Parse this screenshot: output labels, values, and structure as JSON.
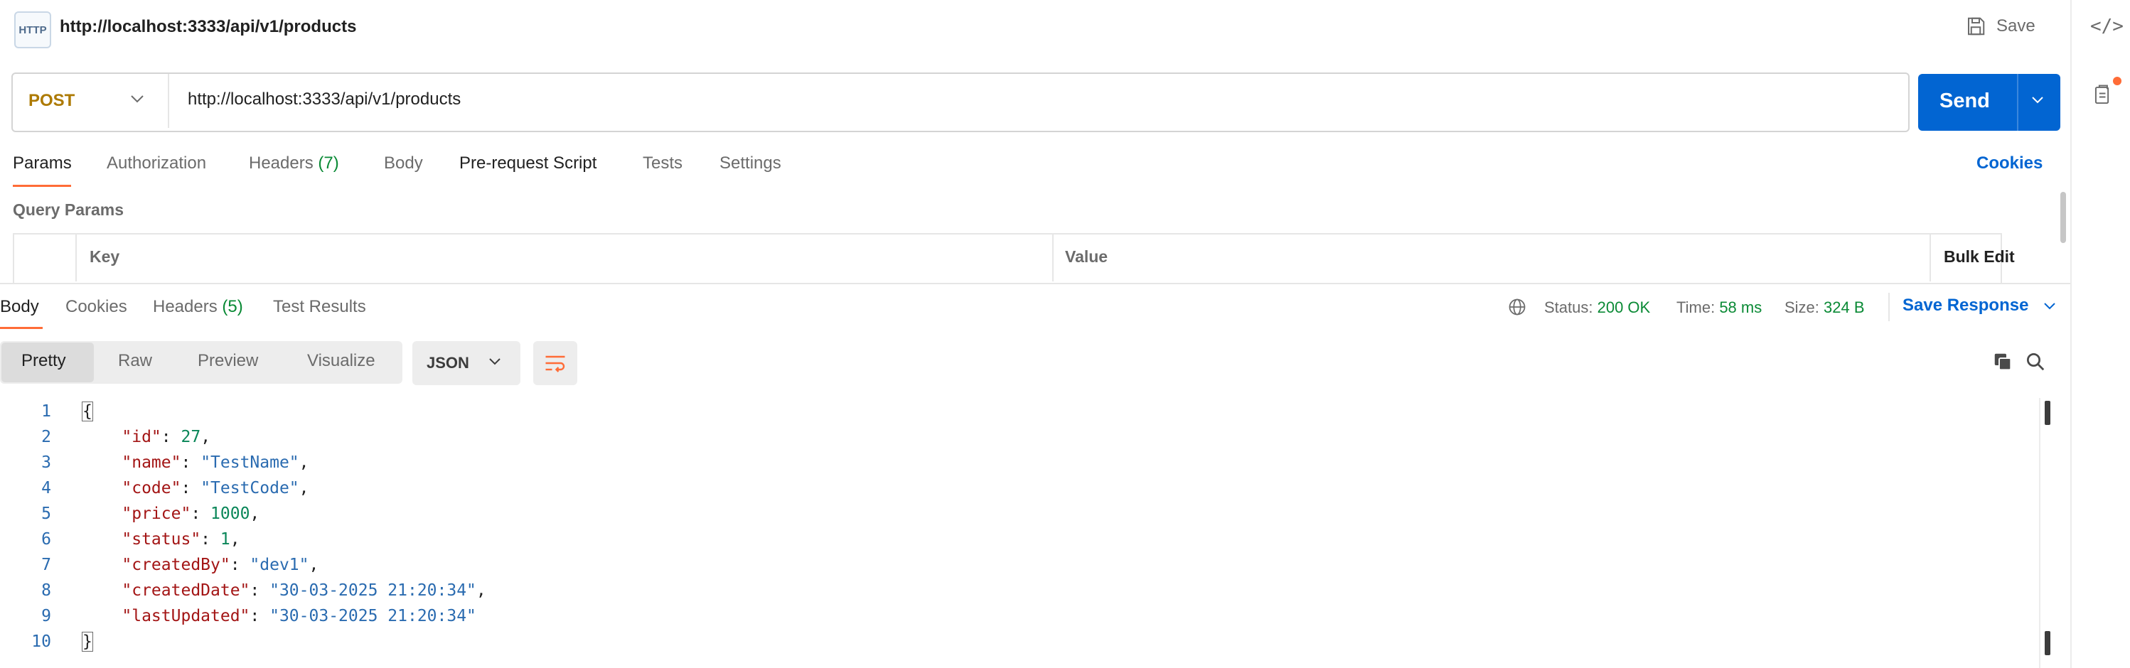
{
  "request": {
    "badge": "HTTP",
    "title": "http://localhost:3333/api/v1/products",
    "save_label": "Save",
    "method": "POST",
    "url": "http://localhost:3333/api/v1/products",
    "send_label": "Send"
  },
  "request_tabs": {
    "params": "Params",
    "authorization": "Authorization",
    "headers": "Headers",
    "headers_count": "(7)",
    "body": "Body",
    "prerequest": "Pre-request Script",
    "tests": "Tests",
    "settings": "Settings",
    "cookies": "Cookies"
  },
  "query_params": {
    "title": "Query Params",
    "key_header": "Key",
    "value_header": "Value",
    "bulk_edit": "Bulk Edit"
  },
  "response_tabs": {
    "body": "Body",
    "cookies": "Cookies",
    "headers": "Headers",
    "headers_count": "(5)",
    "test_results": "Test Results"
  },
  "response_meta": {
    "status_label": "Status:",
    "status_value": "200 OK",
    "time_label": "Time:",
    "time_value": "58 ms",
    "size_label": "Size:",
    "size_value": "324 B",
    "save_response": "Save Response"
  },
  "format": {
    "pretty": "Pretty",
    "raw": "Raw",
    "preview": "Preview",
    "visualize": "Visualize",
    "language": "JSON"
  },
  "response_body": {
    "line_numbers": [
      "1",
      "2",
      "3",
      "4",
      "5",
      "6",
      "7",
      "8",
      "9",
      "10"
    ],
    "open_brace": "{",
    "close_brace": "}",
    "fields": [
      {
        "key": "\"id\"",
        "value": "27",
        "kind": "n",
        "comma": ","
      },
      {
        "key": "\"name\"",
        "value": "\"TestName\"",
        "kind": "s",
        "comma": ","
      },
      {
        "key": "\"code\"",
        "value": "\"TestCode\"",
        "kind": "s",
        "comma": ","
      },
      {
        "key": "\"price\"",
        "value": "1000",
        "kind": "n",
        "comma": ","
      },
      {
        "key": "\"status\"",
        "value": "1",
        "kind": "n",
        "comma": ","
      },
      {
        "key": "\"createdBy\"",
        "value": "\"dev1\"",
        "kind": "s",
        "comma": ","
      },
      {
        "key": "\"createdDate\"",
        "value": "\"30-03-2025 21:20:34\"",
        "kind": "s",
        "comma": ","
      },
      {
        "key": "\"lastUpdated\"",
        "value": "\"30-03-2025 21:20:34\"",
        "kind": "s",
        "comma": ""
      }
    ]
  },
  "colors": {
    "accent": "#ff6c37",
    "send": "#0265d2",
    "method": "#ad7a03",
    "status_ok": "#0a8a35"
  },
  "icons": [
    "http-icon",
    "save-icon",
    "code-icon",
    "docs-icon",
    "chevron-down-icon",
    "globe-icon",
    "wrap-lines-icon",
    "copy-icon",
    "search-icon"
  ]
}
